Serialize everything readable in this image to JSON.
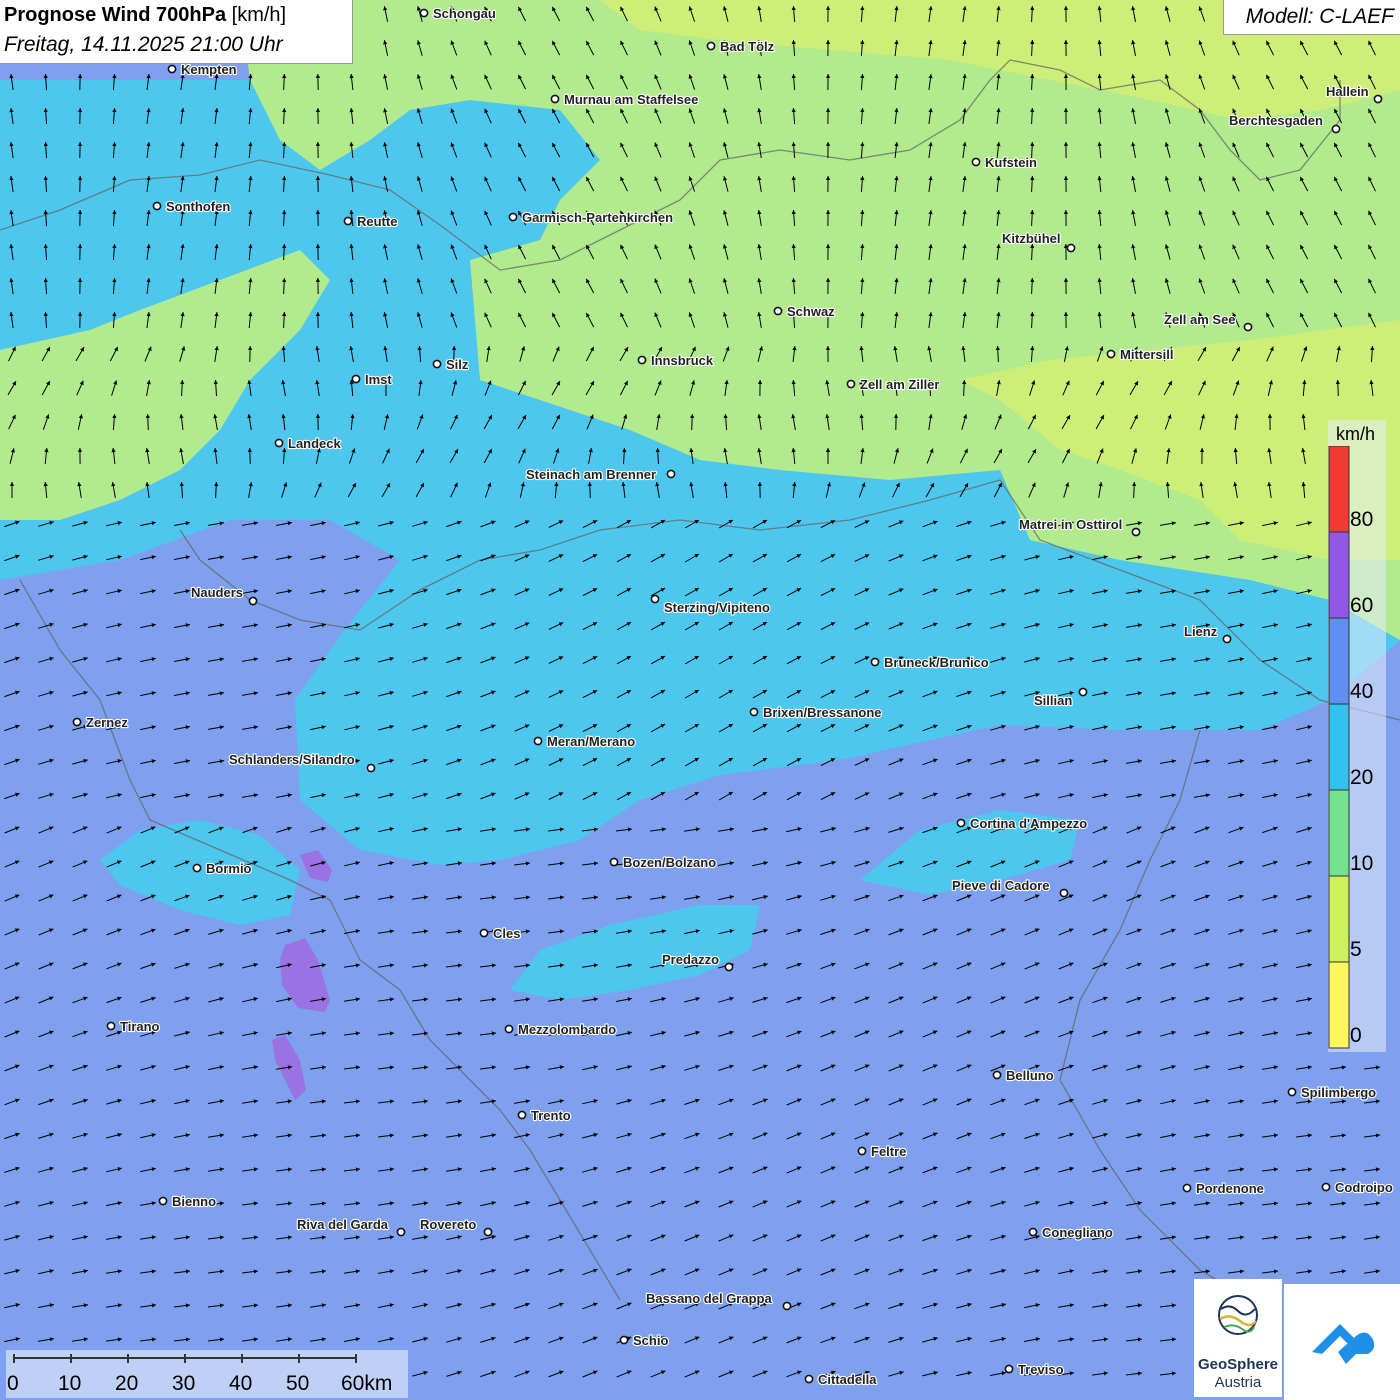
{
  "header": {
    "title": "Prognose Wind 700hPa",
    "unit": "[km/h]",
    "datetime": "Freitag, 14.11.2025 21:00 Uhr",
    "model": "Modell: C-LAEF"
  },
  "legend": {
    "unit": "km/h",
    "labels": [
      "80",
      "60",
      "40",
      "20",
      "10",
      "5",
      "0"
    ],
    "colors": [
      "#f03a32",
      "#8f58e6",
      "#5f8ff2",
      "#32c2ee",
      "#73e48c",
      "#cdf05c",
      "#fff55e"
    ]
  },
  "scale_bar": {
    "labels": [
      "0",
      "10",
      "20",
      "30",
      "40",
      "50",
      "60km"
    ]
  },
  "logo": {
    "name": "GeoSphere",
    "sub": "Austria"
  },
  "colors": {
    "calm_yellow_green": "#cdef78",
    "light_green": "#b2ea8e",
    "cyan": "#4ec7ef",
    "blue": "#7ea0ee",
    "purple": "#9b72e4"
  },
  "cities": [
    {
      "name": "Schongau"
    },
    {
      "name": "Bad Tölz"
    },
    {
      "name": "Kempten"
    },
    {
      "name": "Murnau am Staffelsee"
    },
    {
      "name": "Hallein"
    },
    {
      "name": "Berchtesgaden"
    },
    {
      "name": "Kufstein"
    },
    {
      "name": "Sonthofen"
    },
    {
      "name": "Reutte"
    },
    {
      "name": "Garmisch-Partenkirchen"
    },
    {
      "name": "Kitzbühel"
    },
    {
      "name": "Schwaz"
    },
    {
      "name": "Zell am See"
    },
    {
      "name": "Mittersill"
    },
    {
      "name": "Innsbruck"
    },
    {
      "name": "Silz"
    },
    {
      "name": "Imst"
    },
    {
      "name": "Zell am Ziller"
    },
    {
      "name": "Landeck"
    },
    {
      "name": "Steinach am Brenner"
    },
    {
      "name": "Matrei in Osttirol"
    },
    {
      "name": "Nauders"
    },
    {
      "name": "Sterzing/Vipiteno"
    },
    {
      "name": "Lienz"
    },
    {
      "name": "Bruneck/Brunico"
    },
    {
      "name": "Sillian"
    },
    {
      "name": "Zernez"
    },
    {
      "name": "Brixen/Bressanone"
    },
    {
      "name": "Meran/Merano"
    },
    {
      "name": "Schlanders/Silandro"
    },
    {
      "name": "Cortina d'Ampezzo"
    },
    {
      "name": "Bozen/Bolzano"
    },
    {
      "name": "Bormio"
    },
    {
      "name": "Pieve di Cadore"
    },
    {
      "name": "Cles"
    },
    {
      "name": "Predazzo"
    },
    {
      "name": "Tirano"
    },
    {
      "name": "Mezzolombardo"
    },
    {
      "name": "Belluno"
    },
    {
      "name": "Spilimbergo"
    },
    {
      "name": "Trento"
    },
    {
      "name": "Feltre"
    },
    {
      "name": "Bienno"
    },
    {
      "name": "Pordenone"
    },
    {
      "name": "Codroipo"
    },
    {
      "name": "Riva del Garda"
    },
    {
      "name": "Rovereto"
    },
    {
      "name": "Conegliano"
    },
    {
      "name": "Bassano del Grappa"
    },
    {
      "name": "Schio"
    },
    {
      "name": "Treviso"
    },
    {
      "name": "Cittadella"
    }
  ]
}
